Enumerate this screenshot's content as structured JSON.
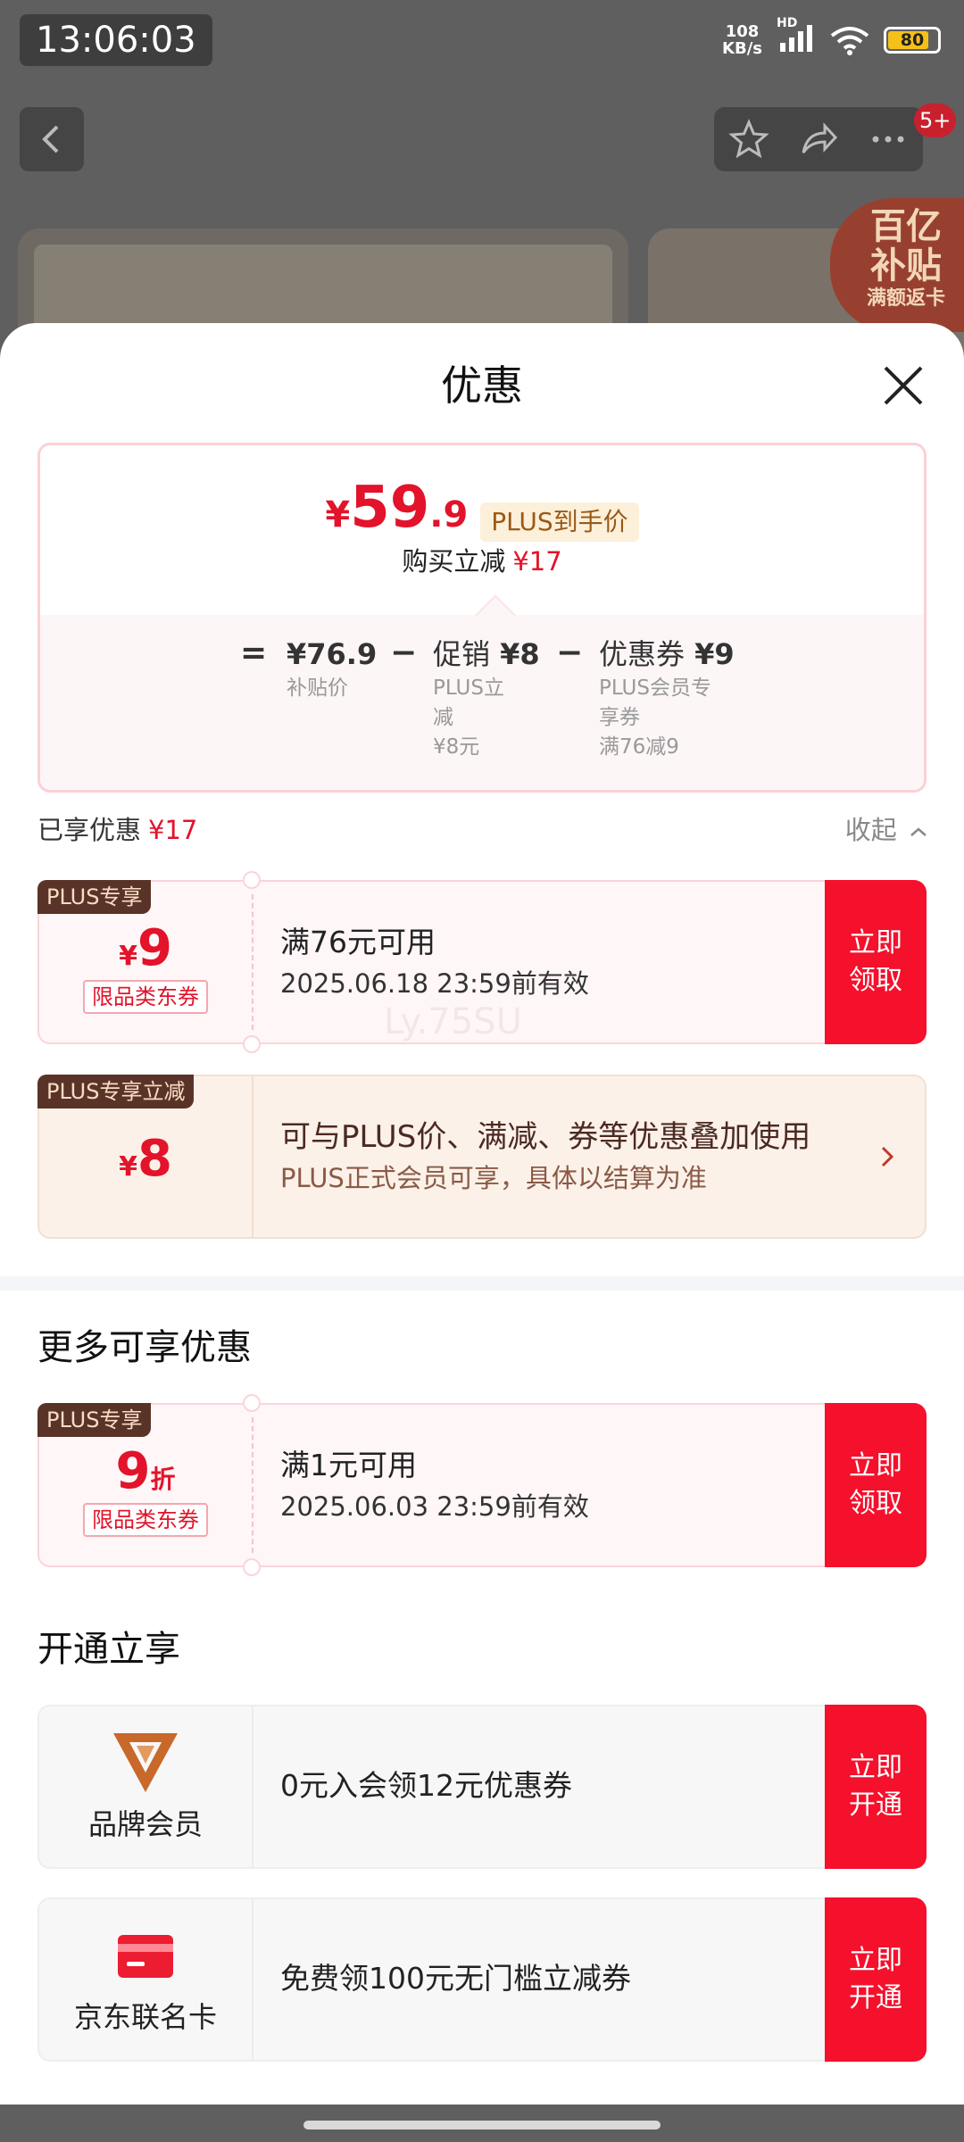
{
  "status_bar": {
    "time": "13:06:03",
    "net_speed_value": "108",
    "net_speed_unit": "KB/s",
    "net_type": "HD",
    "battery": "80"
  },
  "background": {
    "badge": "5+",
    "promo_line1": "百亿",
    "promo_line2": "补贴",
    "promo_line3": "满额返卡"
  },
  "sheet": {
    "title": "优惠",
    "price_card": {
      "currency": "¥",
      "price_int": "59",
      "price_dec": ".9",
      "tag": "PLUS到手价",
      "reduce_label": "购买立减",
      "reduce_amount": "¥17",
      "eq": "=",
      "minus": "−",
      "subsidy_value": "¥76.9",
      "subsidy_label": "补贴价",
      "promo_title": "促销",
      "promo_value": "¥8",
      "promo_sub1": "PLUS立",
      "promo_sub2": "减",
      "promo_sub3": "¥8元",
      "coupon_title": "优惠券",
      "coupon_value": "¥9",
      "coupon_sub1": "PLUS会员专",
      "coupon_sub2": "享券",
      "coupon_sub3": "满76减9"
    },
    "enjoyed": {
      "label": "已享优惠",
      "amount": "¥17",
      "collapse": "收起"
    },
    "coupons": [
      {
        "badge": "PLUS专享",
        "currency": "¥",
        "amount": "9",
        "type": "限品类东券",
        "condition": "满76元可用",
        "expiry": "2025.06.18 23:59前有效",
        "btn1": "立即",
        "btn2": "领取"
      },
      {
        "badge": "PLUS专享立减",
        "currency": "¥",
        "amount": "8",
        "title": "可与PLUS价、满减、券等优惠叠加使用",
        "subtitle": "PLUS正式会员可享，具体以结算为准"
      }
    ],
    "more_title": "更多可享优惠",
    "more_coupon": {
      "badge": "PLUS专享",
      "amount": "9",
      "unit": "折",
      "type": "限品类东券",
      "condition": "满1元可用",
      "expiry": "2025.06.03 23:59前有效",
      "btn1": "立即",
      "btn2": "领取"
    },
    "open_title": "开通立享",
    "open_items": [
      {
        "label": "品牌会员",
        "text": "0元入会领12元优惠券",
        "btn1": "立即",
        "btn2": "开通"
      },
      {
        "label": "京东联名卡",
        "text": "免费领100元无门槛立减券",
        "btn1": "立即",
        "btn2": "开通"
      }
    ],
    "watermark": "Ly.75SU"
  },
  "colors": {
    "accent_red": "#e2132a",
    "button_red": "#f5102c",
    "badge_brown": "#5a3328",
    "brand_orange": "#c8682a"
  }
}
